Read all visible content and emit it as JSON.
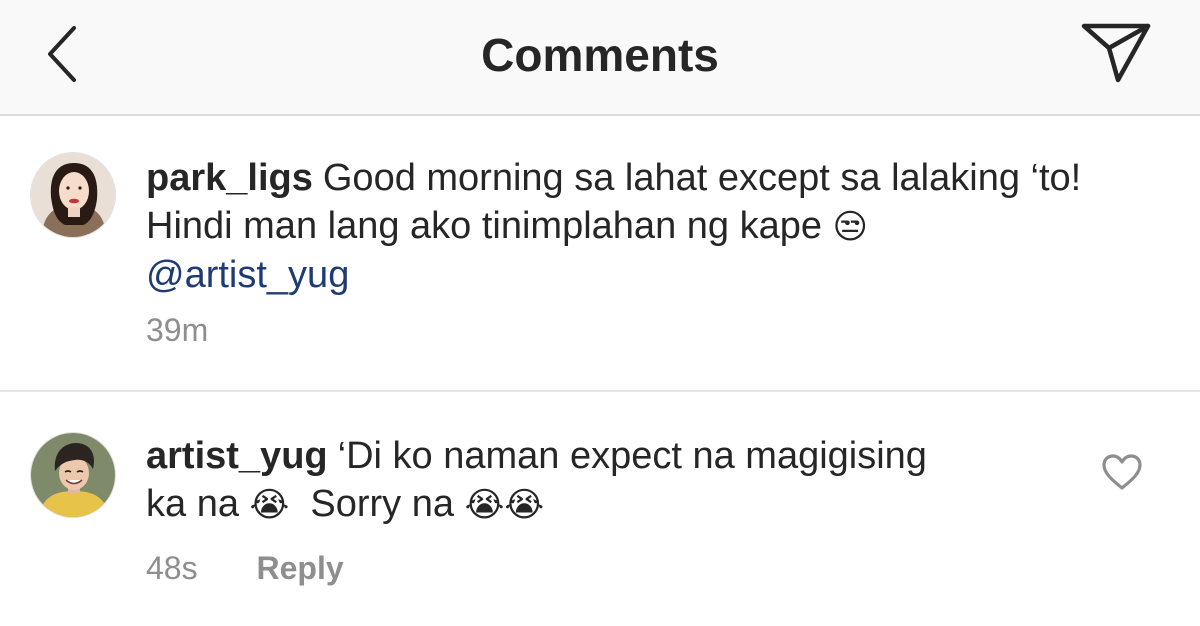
{
  "header": {
    "title": "Comments",
    "back_icon": "chevron-left-icon",
    "send_icon": "paper-plane-icon"
  },
  "comments": [
    {
      "username": "park_ligs",
      "text_line1": "Good morning sa lahat except sa lalaking ‘to!",
      "text_line2": "Hindi man lang ako tinimplahan ng kape",
      "emoji1": "😒",
      "mention": "@artist_yug",
      "time": "39m",
      "avatar_icon": "profile-photo"
    },
    {
      "username": "artist_yug",
      "text_line1": "‘Di ko naman expect na magigising",
      "text_line2_a": "ka na",
      "emoji1": "😭",
      "text_line2_b": "Sorry na",
      "emoji2": "😭",
      "emoji3": "😭",
      "time": "48s",
      "reply_label": "Reply",
      "avatar_icon": "profile-photo",
      "like_icon": "heart-outline-icon"
    }
  ],
  "colors": {
    "text": "#262626",
    "secondary": "#8e8e8e",
    "mention": "#1f3b73",
    "header_bg": "#f9f9f9",
    "divider": "#dbdbdb"
  }
}
